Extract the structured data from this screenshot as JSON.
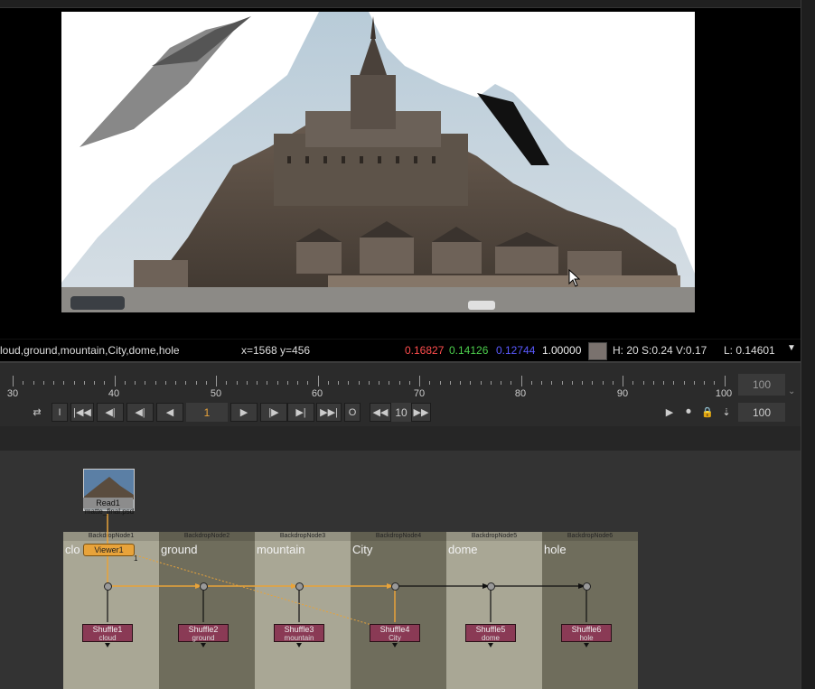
{
  "viewer": {
    "channels_text": "loud,ground,mountain,City,dome,hole",
    "coords": "x=1568 y=456",
    "r": "0.16827",
    "g": "0.14126",
    "b": "0.12744",
    "a": "1.00000",
    "hsv": "H: 20 S:0.24 V:0.17",
    "luminance": "L: 0.14601",
    "swatch_color": "#7a726e",
    "menu_arrow": "▼"
  },
  "timeline": {
    "labels": [
      "30",
      "40",
      "50",
      "60",
      "70",
      "80",
      "90",
      "100"
    ],
    "end_frame_top": "100",
    "end_frame_bottom": "100",
    "current_frame": "1",
    "step": "10",
    "in_label": "I",
    "out_label": "O"
  },
  "nodegraph": {
    "read": {
      "name": "Read1",
      "file": "matte_final.psd"
    },
    "viewer": {
      "name": "Viewer1",
      "input": "1"
    },
    "backdrops": [
      {
        "title": "BackdropNode1",
        "label": "clo"
      },
      {
        "title": "BackdropNode2",
        "label": "ground"
      },
      {
        "title": "BackdropNode3",
        "label": "mountain"
      },
      {
        "title": "BackdropNode4",
        "label": "City"
      },
      {
        "title": "BackdropNode5",
        "label": "dome"
      },
      {
        "title": "BackdropNode6",
        "label": "hole"
      }
    ],
    "shuffles": [
      {
        "name": "Shuffle1",
        "sub": "cloud"
      },
      {
        "name": "Shuffle2",
        "sub": "ground"
      },
      {
        "name": "Shuffle3",
        "sub": "mountain"
      },
      {
        "name": "Shuffle4",
        "sub": "City"
      },
      {
        "name": "Shuffle5",
        "sub": "dome"
      },
      {
        "name": "Shuffle6",
        "sub": "hole"
      }
    ]
  },
  "colors": {
    "accent": "#e8a33a",
    "r": "#ff4d4d",
    "g": "#4dd04d",
    "b": "#5a5aff",
    "shuffle": "#8a3a55"
  }
}
